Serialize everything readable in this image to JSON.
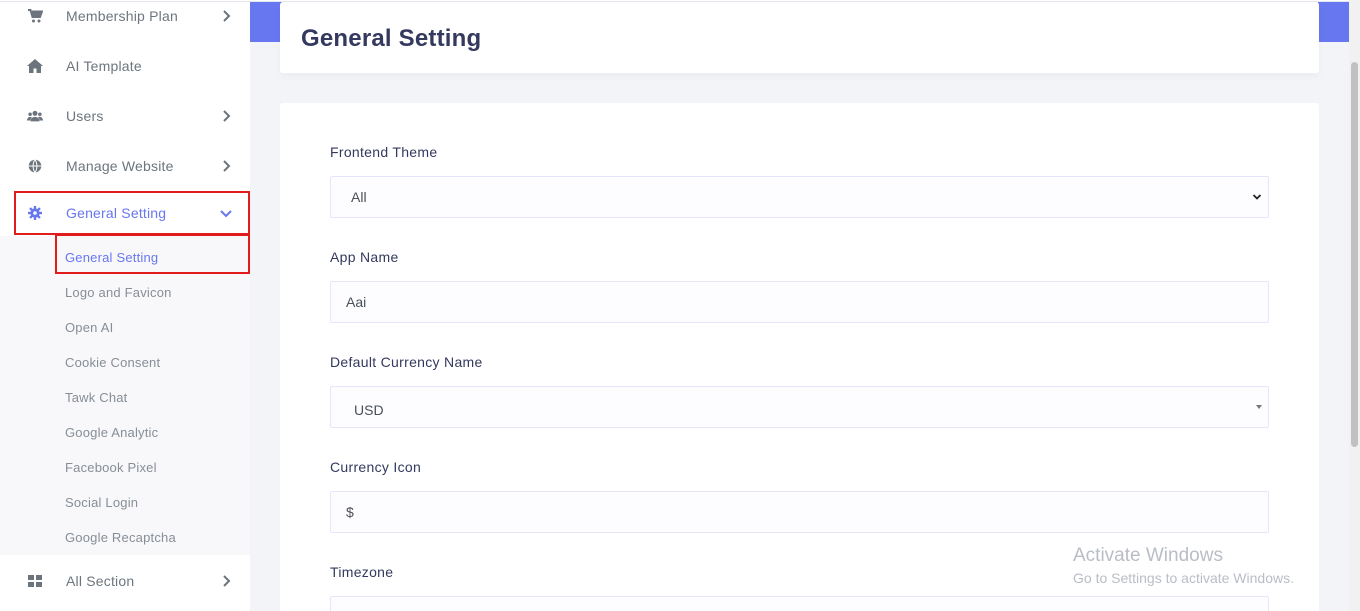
{
  "sidebar": {
    "items": [
      {
        "label": "Membership Plan",
        "icon": "cart-icon"
      },
      {
        "label": "AI Template",
        "icon": "home-icon"
      },
      {
        "label": "Users",
        "icon": "users-icon"
      },
      {
        "label": "Manage Website",
        "icon": "globe-icon"
      },
      {
        "label": "General Setting",
        "icon": "gear-icon"
      },
      {
        "label": "All Section",
        "icon": "grid-icon"
      }
    ],
    "submenu": [
      "General Setting",
      "Logo and Favicon",
      "Open AI",
      "Cookie Consent",
      "Tawk Chat",
      "Google Analytic",
      "Facebook Pixel",
      "Social Login",
      "Google Recaptcha"
    ]
  },
  "header": {
    "title": "General Setting"
  },
  "form": {
    "frontend_theme": {
      "label": "Frontend Theme",
      "value": "All"
    },
    "app_name": {
      "label": "App Name",
      "value": "Aai"
    },
    "default_currency": {
      "label": "Default Currency Name",
      "value": "USD"
    },
    "currency_icon": {
      "label": "Currency Icon",
      "value": "$"
    },
    "timezone": {
      "label": "Timezone"
    }
  },
  "watermark": {
    "title": "Activate Windows",
    "subtitle": "Go to Settings to activate Windows."
  },
  "colors": {
    "accent": "#6777ef",
    "highlight": "#e21b1b"
  }
}
